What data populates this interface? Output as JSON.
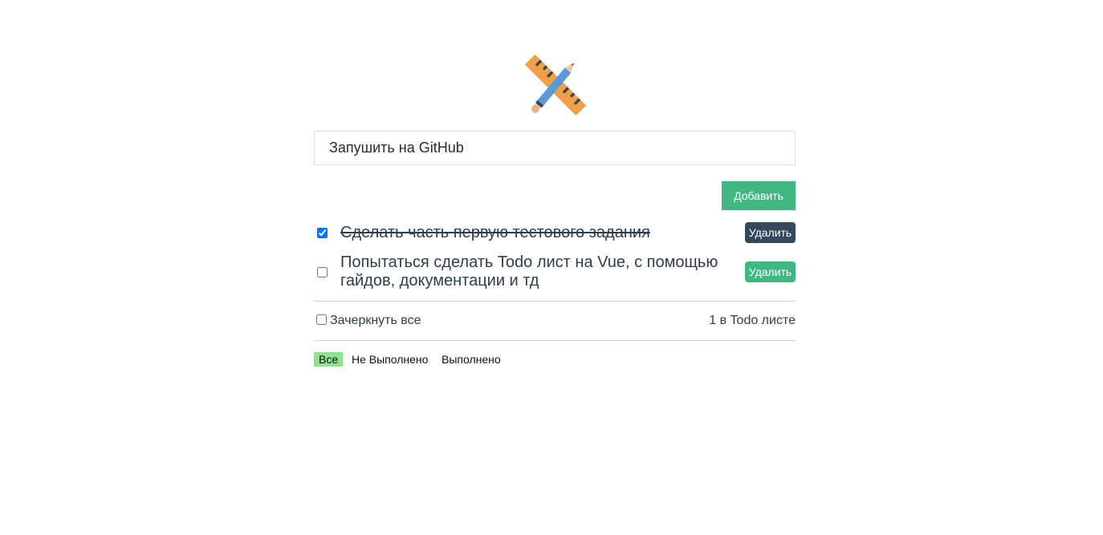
{
  "input": {
    "value": "Запушить на GitHub"
  },
  "add_button_label": "Добавить",
  "todos": [
    {
      "text": "Сделать часть первую тестового задания",
      "completed": true,
      "delete_label": "Удалить"
    },
    {
      "text": "Попытаться сделать Todo лист на Vue, с помощью гайдов, документации и тд",
      "completed": false,
      "delete_label": "Удалить"
    }
  ],
  "footer": {
    "check_all_label": "Зачеркнуть все",
    "counter": "1 в Todo листе"
  },
  "filters": [
    {
      "label": "Все",
      "active": true
    },
    {
      "label": "Не Выполнено",
      "active": false
    },
    {
      "label": "Выполнено",
      "active": false
    }
  ],
  "colors": {
    "accent": "#41b883",
    "dark": "#35495e",
    "active_filter": "#8ee28e",
    "text": "#2c3e50"
  },
  "icons": {
    "logo": "ruler-pencil-icon"
  }
}
